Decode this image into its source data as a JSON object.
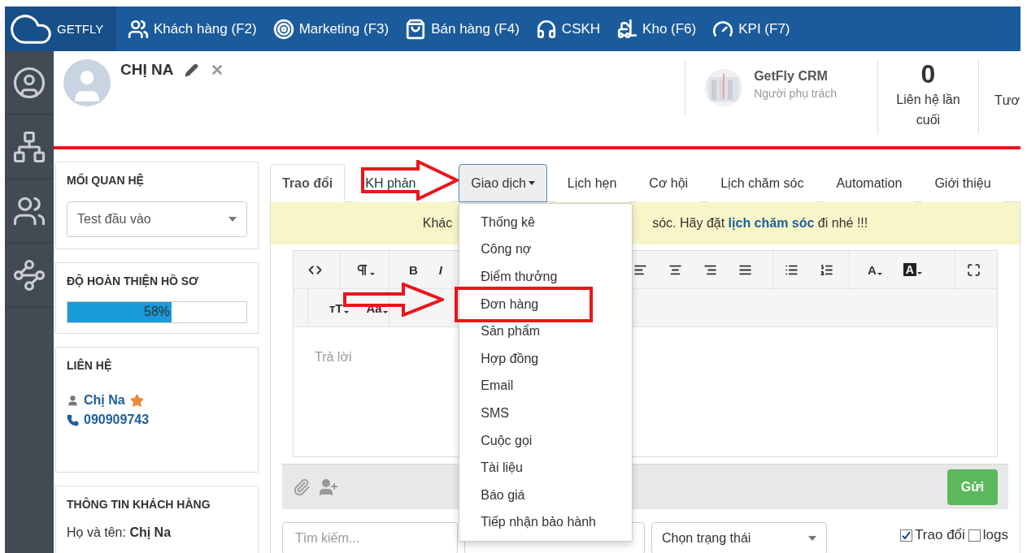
{
  "nav": {
    "brand": "GETFLY",
    "items": [
      {
        "label": "Khách hàng (F2)"
      },
      {
        "label": "Marketing (F3)"
      },
      {
        "label": "Bán hàng (F4)"
      },
      {
        "label": "CSKH"
      },
      {
        "label": "Kho (F6)"
      },
      {
        "label": "KPI (F7)"
      }
    ]
  },
  "profile": {
    "name": "CHỊ NA",
    "owner": {
      "name": "GetFly CRM",
      "role": "Người phụ trách"
    },
    "stats": [
      {
        "value": "0",
        "label": "Liên hệ lần cuối"
      },
      {
        "label": "Tươ"
      }
    ]
  },
  "relationship": {
    "title": "MỐI QUAN HỆ",
    "value": "Test đầu vào"
  },
  "completeness": {
    "title": "ĐỘ HOÀN THIỆN HỒ SƠ",
    "level": 0.58,
    "reading": "58%"
  },
  "contact": {
    "title": "LIÊN HỆ",
    "name": "Chị Na",
    "starred": true,
    "phone": "090909743"
  },
  "info": {
    "title": "THÔNG TIN KHÁCH HÀNG",
    "fields": [
      {
        "label": "Họ và tên:",
        "value": "Chị Na"
      }
    ]
  },
  "tabs": [
    {
      "label": "Trao đổi",
      "kind": "plain",
      "selected": true,
      "open": false
    },
    {
      "label": "KH phản",
      "kind": "plain",
      "selected": false,
      "open": false
    },
    {
      "label": "Giao dịch",
      "kind": "dropdown",
      "selected": false,
      "open": true
    },
    {
      "label": "Lịch hẹn",
      "kind": "plain",
      "selected": false,
      "open": false
    },
    {
      "label": "Cơ hội",
      "kind": "plain",
      "selected": false,
      "open": false
    },
    {
      "label": "Lịch chăm sóc",
      "kind": "plain",
      "selected": false,
      "open": false
    },
    {
      "label": "Automation",
      "kind": "plain",
      "selected": false,
      "open": false
    },
    {
      "label": "Giới thiệu",
      "kind": "plain",
      "selected": false,
      "open": false
    }
  ],
  "menu": {
    "items": [
      {
        "label": "Thống kê",
        "highlighted": false
      },
      {
        "label": "Công nợ",
        "highlighted": false
      },
      {
        "label": "Điểm thưởng",
        "highlighted": false
      },
      {
        "label": "Đơn hàng",
        "highlighted": true
      },
      {
        "label": "Sản phẩm",
        "highlighted": false
      },
      {
        "label": "Hợp đồng",
        "highlighted": false
      },
      {
        "label": "Email",
        "highlighted": false
      },
      {
        "label": "SMS",
        "highlighted": false
      },
      {
        "label": "Cuộc gọi",
        "highlighted": false
      },
      {
        "label": "Tài liệu",
        "highlighted": false
      },
      {
        "label": "Báo giá",
        "highlighted": false
      },
      {
        "label": "Tiếp nhận bảo hành",
        "highlighted": false
      }
    ]
  },
  "notice": {
    "before": "Khác",
    "after": "sóc. Hãy đặt **lịch chăm sóc** đi nhé !!!"
  },
  "toolbar": {
    "buttons": [
      {
        "label": "B",
        "kind": "bold",
        "caret": false
      },
      {
        "label": "I",
        "kind": "italic",
        "caret": false
      },
      {
        "label": "A",
        "kind": "plain",
        "caret": true
      },
      {
        "label": "A",
        "kind": "inverse",
        "caret": true
      },
      {
        "label": "тT",
        "kind": "plain",
        "caret": true
      },
      {
        "label": "Aa",
        "kind": "plain",
        "caret": true
      }
    ]
  },
  "editor": {
    "placeholder": "Trả lời"
  },
  "send_button": "Gửi",
  "filters": {
    "search_placeholder": "Tìm kiếm...",
    "status": "Chọn trạng thái",
    "checks": [
      {
        "label": "Trao đổi",
        "checked": true
      },
      {
        "label": "logs",
        "checked": false
      }
    ]
  }
}
